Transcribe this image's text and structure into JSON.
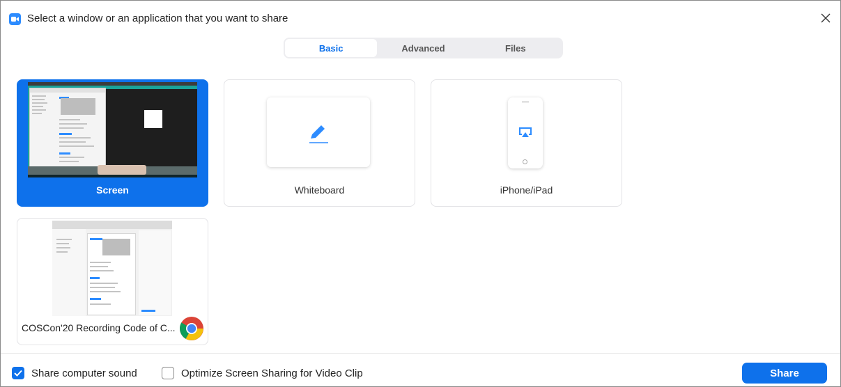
{
  "window": {
    "title": "Select a window or an application that you want to share"
  },
  "tabs": [
    {
      "label": "Basic",
      "active": true
    },
    {
      "label": "Advanced",
      "active": false
    },
    {
      "label": "Files",
      "active": false
    }
  ],
  "tiles": {
    "screen": {
      "label": "Screen",
      "selected": true
    },
    "whiteboard": {
      "label": "Whiteboard",
      "selected": false
    },
    "iphone": {
      "label": "iPhone/iPad",
      "selected": false
    },
    "chrome_window": {
      "label": "COSCon'20 Recording Code of C...",
      "selected": false,
      "app_icon": "chrome-icon"
    }
  },
  "footer": {
    "share_sound": {
      "label": "Share computer sound",
      "checked": true
    },
    "optimize_video": {
      "label": "Optimize Screen Sharing for Video Clip",
      "checked": false
    },
    "share_button": "Share"
  },
  "colors": {
    "accent": "#0e71eb",
    "tab_background": "#ededf0",
    "tile_border": "#e3e3e6"
  }
}
